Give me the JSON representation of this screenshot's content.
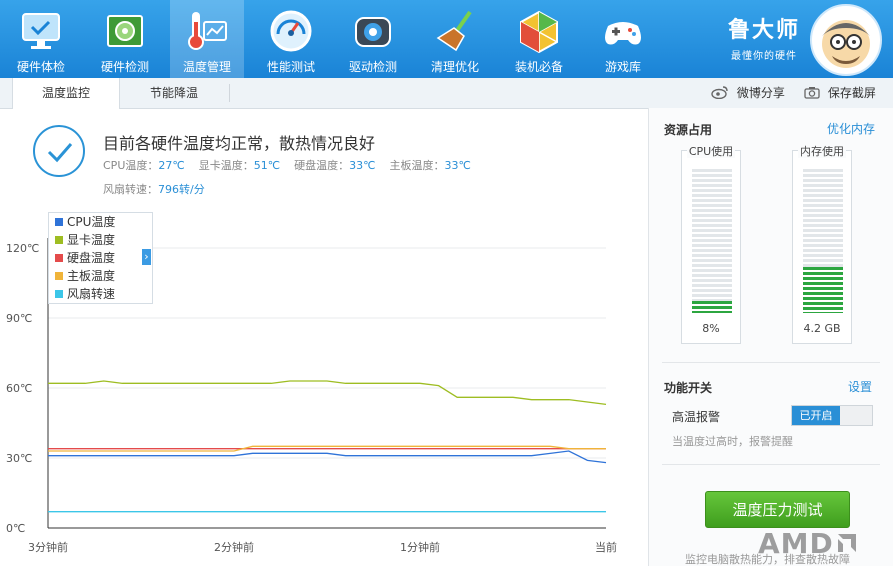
{
  "nav": {
    "items": [
      {
        "label": "硬件体检",
        "icon": "monitor-check-icon"
      },
      {
        "label": "硬件检测",
        "icon": "circuit-board-icon"
      },
      {
        "label": "温度管理",
        "icon": "thermometer-icon"
      },
      {
        "label": "性能测试",
        "icon": "speedometer-icon"
      },
      {
        "label": "驱动检测",
        "icon": "driver-gear-icon"
      },
      {
        "label": "清理优化",
        "icon": "broom-icon"
      },
      {
        "label": "装机必备",
        "icon": "package-box-icon"
      },
      {
        "label": "游戏库",
        "icon": "gamepad-icon"
      }
    ],
    "active_index": 2
  },
  "brand": {
    "name": "鲁大师",
    "slogan": "最懂你的硬件"
  },
  "tabs": [
    {
      "label": "温度监控",
      "active": true
    },
    {
      "label": "节能降温",
      "active": false
    }
  ],
  "share": {
    "weibo": "微博分享",
    "screenshot": "保存截屏"
  },
  "status": {
    "title": "目前各硬件温度均正常，散热情况良好",
    "cpu_label": "CPU温度：",
    "cpu_value": "27℃",
    "gpu_label": "显卡温度：",
    "gpu_value": "51℃",
    "disk_label": "硬盘温度：",
    "disk_value": "33℃",
    "board_label": "主板温度：",
    "board_value": "33℃",
    "fan_label": "风扇转速：",
    "fan_value": "796转/分"
  },
  "chart_data": {
    "type": "line",
    "y_ticks": [
      "120℃",
      "90℃",
      "60℃",
      "30℃",
      "0℃"
    ],
    "ylim": [
      0,
      120
    ],
    "x_ticks": [
      "3分钟前",
      "2分钟前",
      "1分钟前",
      "当前"
    ],
    "x": [
      0,
      1,
      2,
      3,
      4,
      5,
      6,
      7,
      8,
      9,
      10,
      11,
      12,
      13,
      14,
      15,
      16,
      17,
      18,
      19,
      20,
      21,
      22,
      23,
      24,
      25,
      26,
      27,
      28,
      29,
      30
    ],
    "series": [
      {
        "name": "CPU温度",
        "color": "#2f73d8",
        "values": [
          31,
          31,
          31,
          31,
          31,
          31,
          31,
          31,
          31,
          31,
          31,
          32,
          32,
          32,
          32,
          32,
          31,
          31,
          31,
          31,
          31,
          31,
          31,
          31,
          31,
          31,
          31,
          32,
          33,
          29,
          28
        ]
      },
      {
        "name": "显卡温度",
        "color": "#9ebd22",
        "values": [
          62,
          62,
          62,
          63,
          62,
          62,
          62,
          62,
          62,
          62,
          62,
          62,
          62,
          63,
          63,
          63,
          62,
          62,
          62,
          62,
          62,
          61,
          56,
          56,
          56,
          56,
          55,
          55,
          55,
          54,
          53
        ]
      },
      {
        "name": "硬盘温度",
        "color": "#e44b4b",
        "values": [
          34,
          34,
          34,
          34,
          34,
          34,
          34,
          34,
          34,
          34,
          34,
          34,
          34,
          34,
          34,
          34,
          34,
          34,
          34,
          34,
          34,
          34,
          34,
          34,
          34,
          34,
          34,
          34,
          34,
          34,
          34
        ]
      },
      {
        "name": "主板温度",
        "color": "#f0b43a",
        "values": [
          33,
          33,
          33,
          33,
          33,
          33,
          33,
          33,
          33,
          33,
          33,
          35,
          35,
          35,
          35,
          35,
          35,
          35,
          35,
          35,
          35,
          35,
          35,
          35,
          35,
          35,
          35,
          35,
          34,
          34,
          34
        ]
      },
      {
        "name": "风扇转速",
        "color": "#3cc6e8",
        "values": [
          7,
          7,
          7,
          7,
          7,
          7,
          7,
          7,
          7,
          7,
          7,
          7,
          7,
          7,
          7,
          7,
          7,
          7,
          7,
          7,
          7,
          7,
          7,
          7,
          7,
          7,
          7,
          7,
          7,
          7,
          7
        ]
      }
    ],
    "grid": true,
    "legend": "top-left"
  },
  "resources": {
    "title": "资源占用",
    "optimize_link": "优化内存",
    "cpu_title": "CPU使用",
    "cpu_value": "8%",
    "cpu_fraction": 0.08,
    "mem_title": "内存使用",
    "mem_value": "4.2 GB",
    "mem_fraction": 0.32
  },
  "features": {
    "title": "功能开关",
    "settings_link": "设置",
    "alarm_label": "高温报警",
    "alarm_state": "已开启",
    "alarm_desc": "当温度过高时，报警提醒"
  },
  "stress_button": "温度压力测试",
  "footer_note": "监控电脑散热能力，排查散热故障",
  "amd_logo": "AMD"
}
